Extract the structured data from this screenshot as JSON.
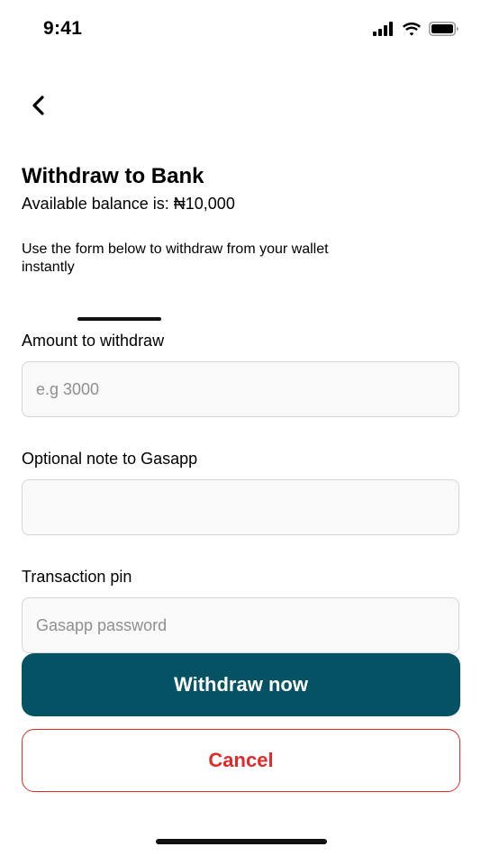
{
  "status_bar": {
    "time": "9:41"
  },
  "icons": {
    "back": "chevron-left-icon",
    "signal": "cellular-signal-icon",
    "wifi": "wifi-icon",
    "battery": "battery-icon"
  },
  "page": {
    "title": "Withdraw to Bank",
    "balance": "Available balance is: ₦10,000",
    "description": "Use the form below to withdraw from your wallet instantly"
  },
  "form": {
    "amount": {
      "label": "Amount to withdraw",
      "value": "",
      "placeholder": "e.g 3000"
    },
    "note": {
      "label": "Optional note to Gasapp",
      "value": "",
      "placeholder": ""
    },
    "pin": {
      "label": "Transaction pin",
      "value": "",
      "placeholder": "Gasapp password"
    }
  },
  "actions": {
    "primary_label": "Withdraw now",
    "secondary_label": "Cancel"
  },
  "colors": {
    "primary": "#045264",
    "danger": "#e02b2b",
    "field_bg": "#f9f9f9",
    "field_border": "#d6d6d6"
  }
}
